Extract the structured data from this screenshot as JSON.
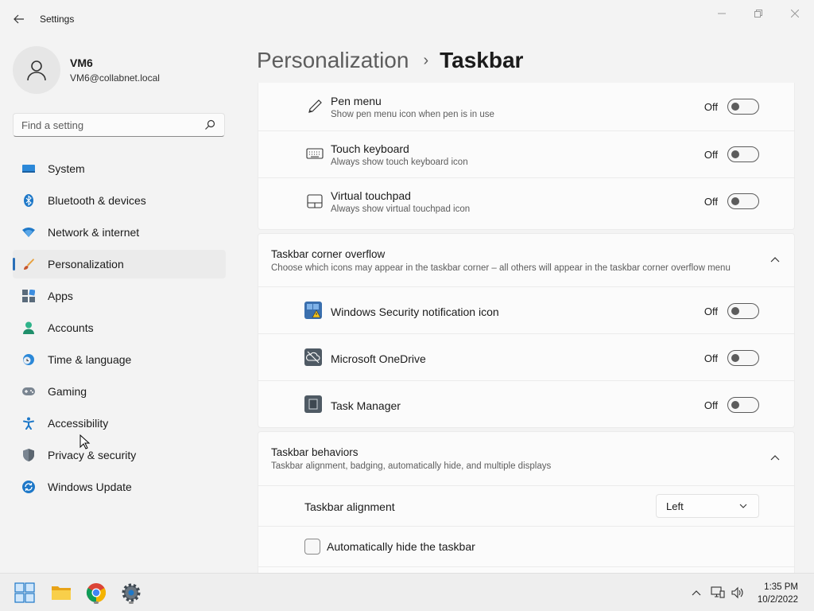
{
  "window": {
    "title": "Settings",
    "controls": {
      "minimize": "minimize-icon",
      "maximize": "restore-icon",
      "close": "close-icon"
    }
  },
  "profile": {
    "name": "VM6",
    "email": "VM6@collabnet.local"
  },
  "search": {
    "placeholder": "Find a setting"
  },
  "sidebar": {
    "items": [
      {
        "label": "System",
        "icon": "monitor-icon"
      },
      {
        "label": "Bluetooth & devices",
        "icon": "bluetooth-icon"
      },
      {
        "label": "Network & internet",
        "icon": "wifi-icon"
      },
      {
        "label": "Personalization",
        "icon": "brush-icon",
        "selected": true
      },
      {
        "label": "Apps",
        "icon": "apps-icon"
      },
      {
        "label": "Accounts",
        "icon": "person-icon"
      },
      {
        "label": "Time & language",
        "icon": "globe-clock-icon"
      },
      {
        "label": "Gaming",
        "icon": "gamepad-icon"
      },
      {
        "label": "Accessibility",
        "icon": "accessibility-icon"
      },
      {
        "label": "Privacy & security",
        "icon": "shield-icon"
      },
      {
        "label": "Windows Update",
        "icon": "update-icon"
      }
    ]
  },
  "breadcrumb": {
    "parent": "Personalization",
    "separator": "›",
    "current": "Taskbar"
  },
  "pen_section": {
    "rows": [
      {
        "title": "Pen menu",
        "subtitle": "Show pen menu icon when pen is in use",
        "state": "Off",
        "icon": "pen-icon"
      },
      {
        "title": "Touch keyboard",
        "subtitle": "Always show touch keyboard icon",
        "state": "Off",
        "icon": "keyboard-icon"
      },
      {
        "title": "Virtual touchpad",
        "subtitle": "Always show virtual touchpad icon",
        "state": "Off",
        "icon": "touchpad-icon"
      }
    ]
  },
  "overflow_section": {
    "title": "Taskbar corner overflow",
    "subtitle": "Choose which icons may appear in the taskbar corner – all others will appear in the taskbar corner overflow menu",
    "rows": [
      {
        "title": "Windows Security notification icon",
        "state": "Off",
        "icon": "windows-security-icon"
      },
      {
        "title": "Microsoft OneDrive",
        "state": "Off",
        "icon": "onedrive-icon"
      },
      {
        "title": "Task Manager",
        "state": "Off",
        "icon": "task-manager-icon"
      }
    ]
  },
  "behaviors_section": {
    "title": "Taskbar behaviors",
    "subtitle": "Taskbar alignment, badging, automatically hide, and multiple displays",
    "alignment_label": "Taskbar alignment",
    "alignment_value": "Left",
    "autohide_label": "Automatically hide the taskbar",
    "autohide_checked": false
  },
  "taskbar": {
    "apps": [
      "start-icon",
      "file-explorer-icon",
      "chrome-icon",
      "settings-gear-icon"
    ],
    "tray": [
      "chevron-up-icon",
      "network-icon",
      "volume-icon"
    ],
    "time": "1:35 PM",
    "date": "10/2/2022"
  },
  "colors": {
    "accent": "#2a6fb8",
    "background": "#f3f3f3",
    "card": "#fbfbfb"
  }
}
